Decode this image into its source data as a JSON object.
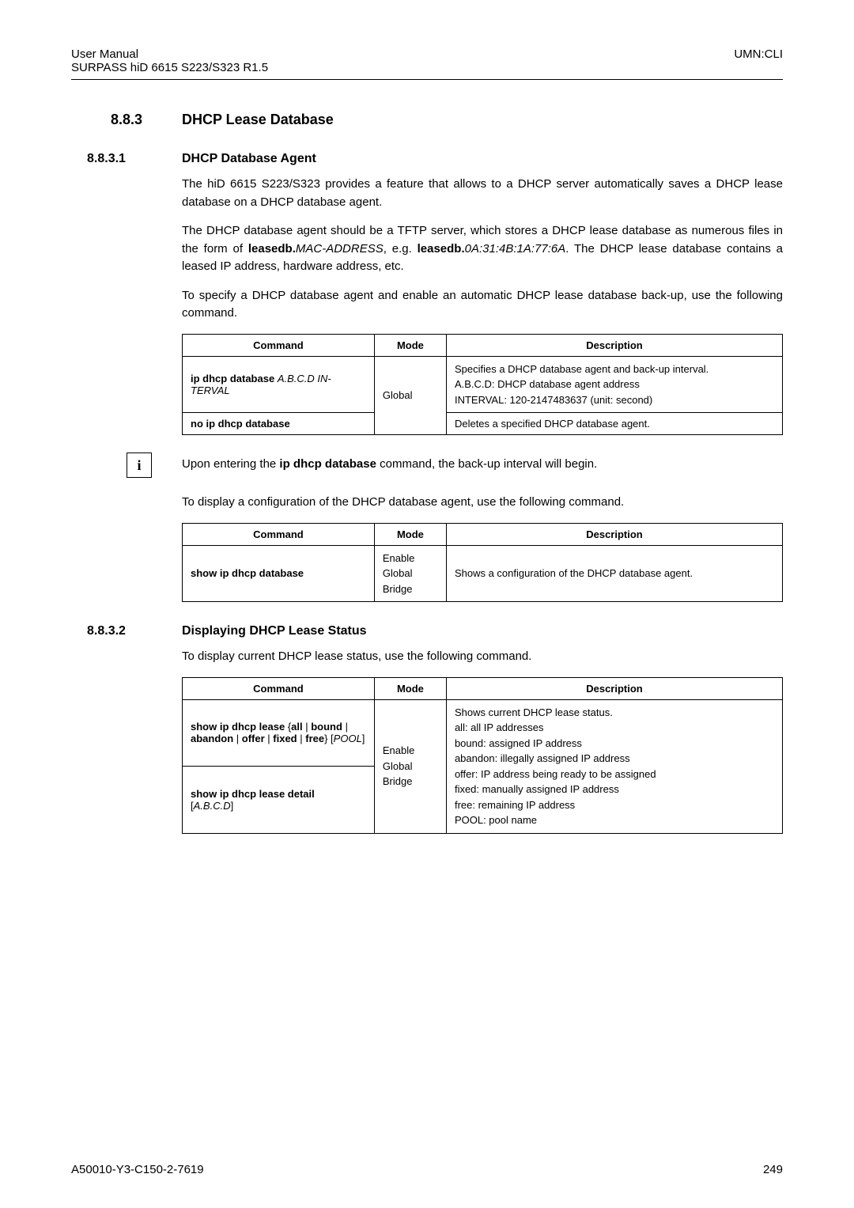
{
  "header": {
    "left_line1": "User Manual",
    "left_line2": "SURPASS hiD 6615 S223/S323 R1.5",
    "right": "UMN:CLI"
  },
  "section": {
    "number": "8.8.3",
    "title": "DHCP Lease Database"
  },
  "sub1": {
    "number": "8.8.3.1",
    "title": "DHCP Database Agent",
    "p1": "The hiD 6615 S223/S323 provides a feature that allows to a DHCP server automatically saves a DHCP lease database on a DHCP database agent.",
    "p2a": "The DHCP database agent should be a TFTP server, which stores a DHCP lease database as numerous files in the form of ",
    "p2b": "leasedb.",
    "p2c": "MAC-ADDRESS",
    "p2d": ", e.g. ",
    "p2e": "leasedb.",
    "p2f": "0A:31:4B:1A:77:6A",
    "p2g": ". The DHCP lease database contains a leased IP address, hardware address, etc.",
    "p3": "To specify a DHCP database agent and enable an automatic DHCP lease database back-up, use the following command."
  },
  "table1": {
    "h1": "Command",
    "h2": "Mode",
    "h3": "Description",
    "r1_cmd_a": "ip dhcp database ",
    "r1_cmd_b": "A.B.C.D IN-TERVAL",
    "r1_mode": "Global",
    "r1_desc_l1": "Specifies a DHCP database agent and back-up interval.",
    "r1_desc_l2": "A.B.C.D: DHCP database agent address",
    "r1_desc_l3": "INTERVAL: 120-2147483637 (unit: second)",
    "r2_cmd": "no ip dhcp database",
    "r2_desc": "Deletes a specified DHCP database agent."
  },
  "info": {
    "icon": "i",
    "text_a": "Upon entering the ",
    "text_b": "ip dhcp database",
    "text_c": " command, the back-up interval will begin."
  },
  "p_after_info": "To display a configuration of the DHCP database agent, use the following command.",
  "table2": {
    "h1": "Command",
    "h2": "Mode",
    "h3": "Description",
    "r1_cmd": "show ip dhcp database",
    "r1_mode_l1": "Enable",
    "r1_mode_l2": "Global",
    "r1_mode_l3": "Bridge",
    "r1_desc": "Shows a configuration of the DHCP database agent."
  },
  "sub2": {
    "number": "8.8.3.2",
    "title": "Displaying DHCP Lease Status",
    "p1": "To display current DHCP lease status, use the following command."
  },
  "table3": {
    "h1": "Command",
    "h2": "Mode",
    "h3": "Description",
    "r1_cmd_a": "show ip dhcp lease ",
    "r1_cmd_b": "{",
    "r1_cmd_c": "all",
    "r1_cmd_d": " | ",
    "r1_cmd_e": "bound",
    "r1_cmd_f": " | ",
    "r1_cmd_g": "abandon",
    "r1_cmd_h": " | ",
    "r1_cmd_i": "offer",
    "r1_cmd_j": " | ",
    "r1_cmd_k": "fixed",
    "r1_cmd_l": " | ",
    "r1_cmd_m": "free",
    "r1_cmd_n": "} [",
    "r1_cmd_o": "POOL",
    "r1_cmd_p": "]",
    "r2_cmd_a": "show ip dhcp lease detail",
    "r2_cmd_b": " [",
    "r2_cmd_c": "A.B.C.D",
    "r2_cmd_d": "]",
    "mode_l1": "Enable",
    "mode_l2": "Global",
    "mode_l3": "Bridge",
    "desc_l1": "Shows current DHCP lease status.",
    "desc_l2": "all: all IP addresses",
    "desc_l3": "bound: assigned IP address",
    "desc_l4": "abandon: illegally assigned IP address",
    "desc_l5": "offer: IP address being ready to be assigned",
    "desc_l6": "fixed: manually assigned IP address",
    "desc_l7": "free: remaining IP address",
    "desc_l8": "POOL: pool name"
  },
  "footer": {
    "left": "A50010-Y3-C150-2-7619",
    "right": "249"
  }
}
